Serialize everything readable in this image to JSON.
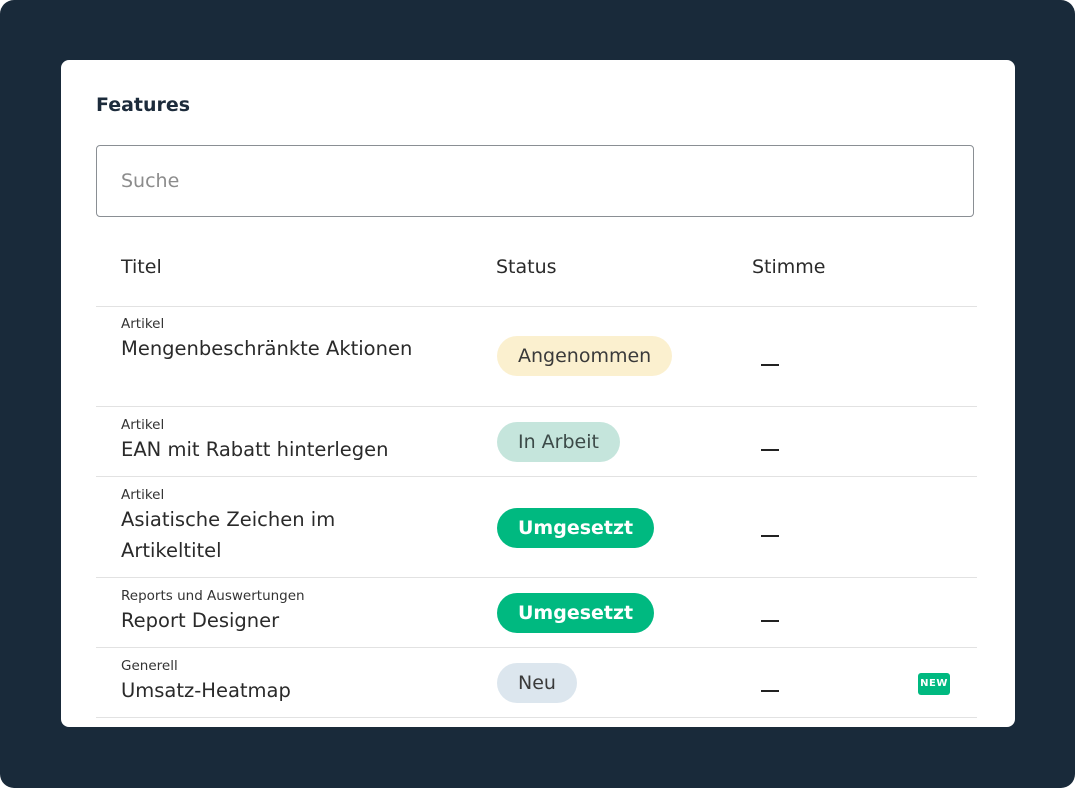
{
  "card": {
    "title": "Features",
    "search": {
      "placeholder": "Suche",
      "value": ""
    }
  },
  "table": {
    "headers": {
      "title": "Titel",
      "status": "Status",
      "vote": "Stimme"
    },
    "rows": [
      {
        "category": "Artikel",
        "name": "Mengenbeschränkte Aktionen",
        "status": "Angenommen",
        "vote": "–",
        "badge": ""
      },
      {
        "category": "Artikel",
        "name": "EAN mit Rabatt hinterlegen",
        "status": "In Arbeit",
        "vote": "–",
        "badge": ""
      },
      {
        "category": "Artikel",
        "name": "Asiatische Zeichen im Artikeltitel",
        "status": "Umgesetzt",
        "vote": "–",
        "badge": ""
      },
      {
        "category": "Reports und Auswertungen",
        "name": "Report Designer",
        "status": "Umgesetzt",
        "vote": "–",
        "badge": ""
      },
      {
        "category": "Generell",
        "name": "Umsatz-Heatmap",
        "status": "Neu",
        "vote": "–",
        "badge": "NEW"
      }
    ]
  },
  "colors": {
    "background": "#192a3a",
    "accent": "#00b980",
    "status_accepted": "#fbf0cf",
    "status_in_work": "#c5e5dc",
    "status_new": "#dce6ee"
  }
}
